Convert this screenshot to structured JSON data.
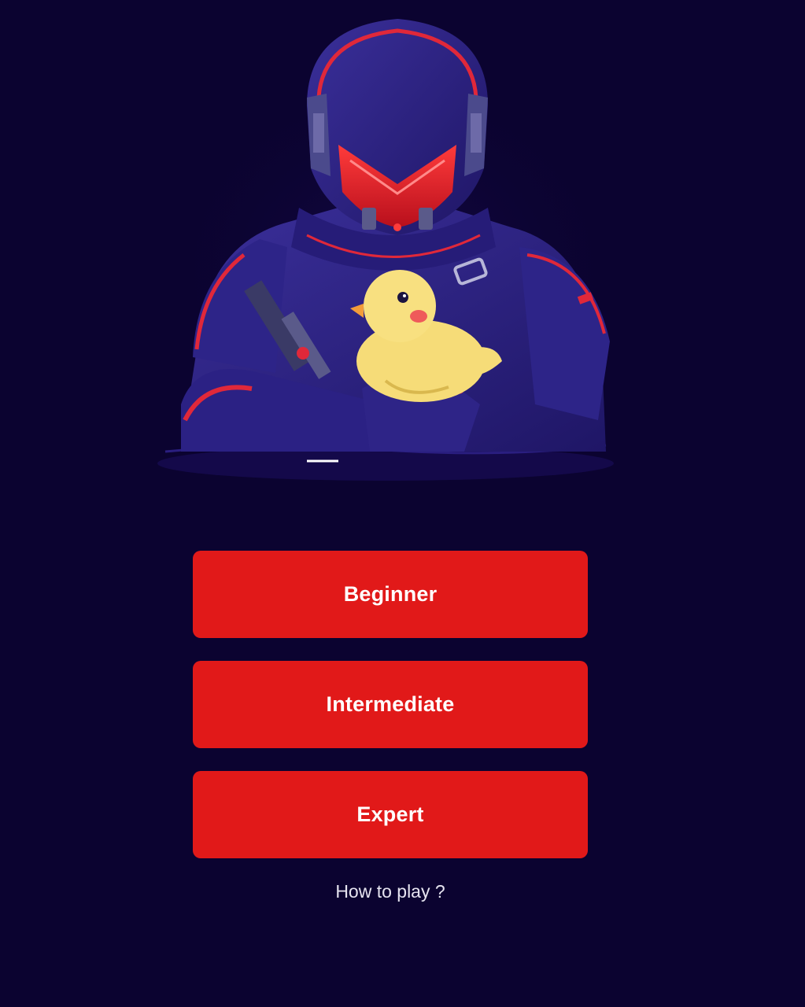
{
  "background_color": "#0b0330",
  "accent_color": "#e11919",
  "hero": {
    "icon": "soldier-holding-duck-illustration"
  },
  "menu": {
    "buttons": [
      {
        "label": "Beginner"
      },
      {
        "label": "Intermediate"
      },
      {
        "label": "Expert"
      }
    ]
  },
  "help": {
    "label": "How to play ?"
  }
}
